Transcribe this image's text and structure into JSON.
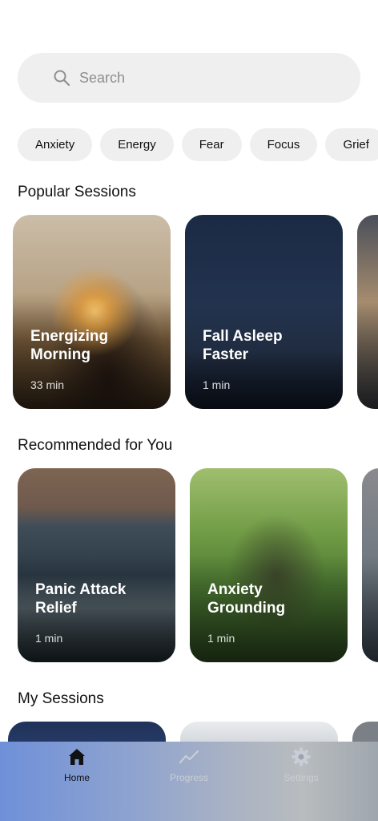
{
  "search": {
    "placeholder": "Search",
    "icon": "search-icon"
  },
  "filters": [
    "Anxiety",
    "Energy",
    "Fear",
    "Focus",
    "Grief"
  ],
  "sections": {
    "popular": {
      "title": "Popular Sessions",
      "cards": [
        {
          "title": "Energizing\nMorning",
          "duration": "33 min",
          "image": "sunrise-silhouette"
        },
        {
          "title": "Fall Asleep\nFaster",
          "duration": "1 min",
          "image": "night-sky"
        },
        {
          "title": "",
          "duration": "",
          "image": "dusk-landscape"
        }
      ]
    },
    "recommended": {
      "title": "Recommended for You",
      "cards": [
        {
          "title": "Panic Attack\nRelief",
          "duration": "1 min",
          "image": "stormy-coast"
        },
        {
          "title": "Anxiety\nGrounding",
          "duration": "1 min",
          "image": "forest-stump"
        },
        {
          "title": "",
          "duration": "",
          "image": "mountain-lake"
        }
      ]
    },
    "mine": {
      "title": "My Sessions"
    }
  },
  "tabbar": {
    "tabs": [
      {
        "label": "Home",
        "icon": "home-icon",
        "active": true
      },
      {
        "label": "Progress",
        "icon": "progress-icon",
        "active": false
      },
      {
        "label": "Settings",
        "icon": "gear-icon",
        "active": false
      }
    ]
  },
  "colors": {
    "chip_bg": "#efefef",
    "search_bg": "#efefef",
    "text": "#111111",
    "inactive_tab": "#c9ced6"
  }
}
